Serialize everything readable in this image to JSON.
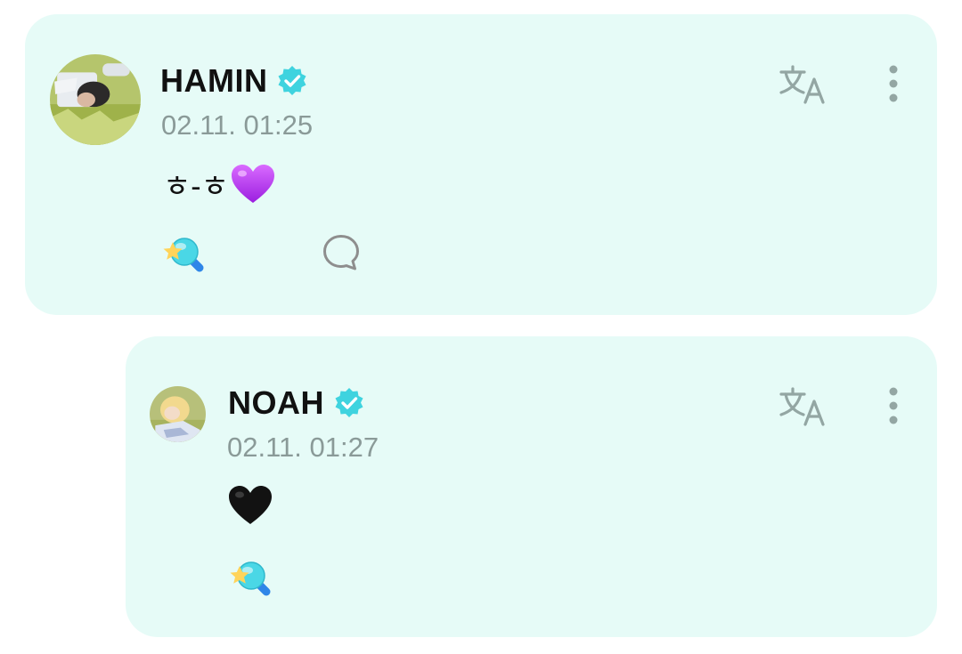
{
  "posts": [
    {
      "author": "HAMIN",
      "verified": true,
      "timestamp": "02.11. 01:25",
      "text": "ㅎ-ㅎ",
      "emoji": "purple-heart",
      "actions": [
        "reaction-icon",
        "comment-icon"
      ]
    },
    {
      "author": "NOAH",
      "verified": true,
      "timestamp": "02.11. 01:27",
      "text": "",
      "emoji": "black-heart",
      "actions": [
        "reaction-icon"
      ]
    }
  ],
  "icons": {
    "translate": "translate-icon",
    "more": "more-vertical-icon",
    "verified": "verified-badge-icon"
  },
  "colors": {
    "card_bg": "#e6fbf7",
    "accent": "#3fd3df",
    "muted": "#8a9a98"
  }
}
